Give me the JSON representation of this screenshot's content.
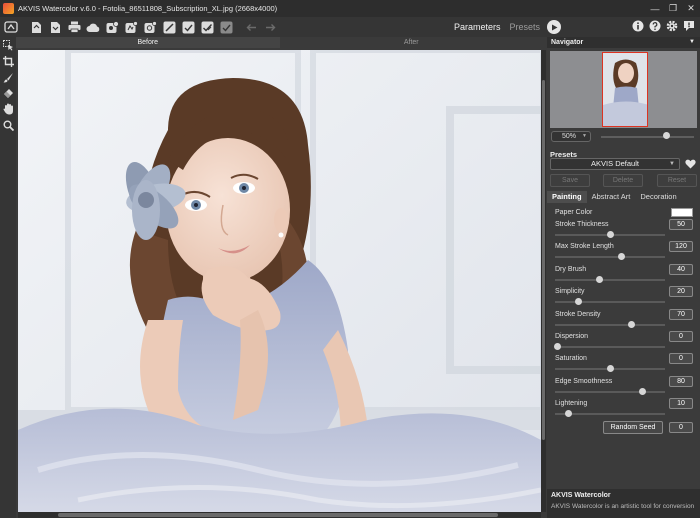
{
  "window": {
    "title": "AKVIS Watercolor v.6.0 - Fotolia_86511808_Subscription_XL.jpg (2668x4000)",
    "controls": [
      "—",
      "❐",
      "✕"
    ]
  },
  "toolbar": {
    "tabs": {
      "parameters": "Parameters",
      "presets": "Presets"
    },
    "icons": [
      "home-icon",
      "open-icon",
      "save-icon",
      "print-icon",
      "cloud-icon",
      "batch-icon",
      "plugin-icon",
      "settings-icon",
      "brush-icon",
      "check-icon",
      "check-all-icon",
      "undo-icon",
      "redo-icon",
      "run-icon",
      "info-icon",
      "help-icon",
      "gear-icon",
      "feedback-icon"
    ]
  },
  "view": {
    "before": "Before",
    "after": "After"
  },
  "navigator": {
    "title": "Navigator",
    "zoom": "50%",
    "zoom_level": 0.72
  },
  "presets": {
    "title": "Presets",
    "selected": "AKVIS Default",
    "save": "Save",
    "delete": "Delete",
    "reset": "Reset"
  },
  "subtabs": [
    "Painting",
    "Abstract Art",
    "Decoration"
  ],
  "params": {
    "paper_color": {
      "label": "Paper Color",
      "color": "#ffffff"
    },
    "items": [
      {
        "label": "Stroke Thickness",
        "value": "50",
        "level": 0.5
      },
      {
        "label": "Max Stroke Length",
        "value": "120",
        "level": 0.6
      },
      {
        "label": "Dry Brush",
        "value": "40",
        "level": 0.4
      },
      {
        "label": "Simplicity",
        "value": "20",
        "level": 0.2
      },
      {
        "label": "Stroke Density",
        "value": "70",
        "level": 0.7
      },
      {
        "label": "Dispersion",
        "value": "0",
        "level": 0.0
      },
      {
        "label": "Saturation",
        "value": "0",
        "level": 0.5
      },
      {
        "label": "Edge Smoothness",
        "value": "80",
        "level": 0.8
      },
      {
        "label": "Lightening",
        "value": "10",
        "level": 0.1
      }
    ],
    "random_seed_label": "Random Seed",
    "random_seed": "0"
  },
  "help": {
    "title": "AKVIS Watercolor",
    "text": "AKVIS Watercolor is an artistic tool for conversion"
  }
}
